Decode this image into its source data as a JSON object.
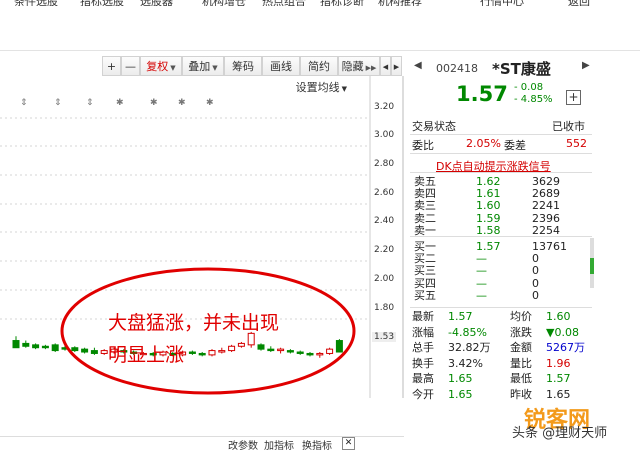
{
  "top_menu": {
    "items": [
      "条件选股",
      "指标选股",
      "选股器",
      "机构增仓",
      "热点组合",
      "指标诊断",
      "机构推荐",
      "行情中心",
      "返回"
    ]
  },
  "toolbar": {
    "plus": "+",
    "minus": "—",
    "fuquan": "复权",
    "diejia": "叠加",
    "chouma": "筹码",
    "huaxian": "画线",
    "jianyue": "简约",
    "yincang": "隐藏",
    "arrows": "▶▶",
    "nav_left": "◀",
    "nav_right": "▶"
  },
  "chart": {
    "setting_label": "设置均线",
    "price_labels": [
      "3.20",
      "3.00",
      "2.80",
      "2.60",
      "2.40",
      "2.20",
      "2.00",
      "1.80",
      "1.53"
    ],
    "annotation_lines": [
      "大盘猛涨，并未出现",
      "明显上涨"
    ],
    "bottom_tools": {
      "gai_zhibiao": "改参数",
      "jia_zhibiao": "加指标",
      "huan_zhibiao": "换指标",
      "close": "✕"
    },
    "marks": [
      "⇕",
      "⇕",
      "⇕",
      "✱",
      "✱",
      "✱",
      "✱"
    ]
  },
  "chart_data": {
    "type": "candlestick",
    "y_range": [
      1.53,
      3.2
    ],
    "candles": [
      {
        "o": 1.65,
        "h": 1.68,
        "l": 1.6,
        "c": 1.6
      },
      {
        "o": 1.63,
        "h": 1.65,
        "l": 1.6,
        "c": 1.61
      },
      {
        "o": 1.62,
        "h": 1.63,
        "l": 1.59,
        "c": 1.6
      },
      {
        "o": 1.61,
        "h": 1.62,
        "l": 1.59,
        "c": 1.6
      },
      {
        "o": 1.62,
        "h": 1.63,
        "l": 1.57,
        "c": 1.58
      },
      {
        "o": 1.6,
        "h": 1.62,
        "l": 1.58,
        "c": 1.59
      },
      {
        "o": 1.6,
        "h": 1.61,
        "l": 1.57,
        "c": 1.58
      },
      {
        "o": 1.59,
        "h": 1.6,
        "l": 1.56,
        "c": 1.57
      },
      {
        "o": 1.58,
        "h": 1.6,
        "l": 1.55,
        "c": 1.56
      },
      {
        "o": 1.56,
        "h": 1.59,
        "l": 1.55,
        "c": 1.58
      },
      {
        "o": 1.57,
        "h": 1.6,
        "l": 1.56,
        "c": 1.59
      },
      {
        "o": 1.58,
        "h": 1.59,
        "l": 1.56,
        "c": 1.57
      },
      {
        "o": 1.57,
        "h": 1.58,
        "l": 1.55,
        "c": 1.56
      },
      {
        "o": 1.56,
        "h": 1.57,
        "l": 1.55,
        "c": 1.56
      },
      {
        "o": 1.56,
        "h": 1.57,
        "l": 1.54,
        "c": 1.55
      },
      {
        "o": 1.55,
        "h": 1.58,
        "l": 1.54,
        "c": 1.57
      },
      {
        "o": 1.56,
        "h": 1.57,
        "l": 1.54,
        "c": 1.55
      },
      {
        "o": 1.55,
        "h": 1.58,
        "l": 1.54,
        "c": 1.57
      },
      {
        "o": 1.57,
        "h": 1.58,
        "l": 1.55,
        "c": 1.56
      },
      {
        "o": 1.56,
        "h": 1.57,
        "l": 1.54,
        "c": 1.55
      },
      {
        "o": 1.55,
        "h": 1.59,
        "l": 1.54,
        "c": 1.58
      },
      {
        "o": 1.57,
        "h": 1.6,
        "l": 1.56,
        "c": 1.58
      },
      {
        "o": 1.58,
        "h": 1.62,
        "l": 1.57,
        "c": 1.61
      },
      {
        "o": 1.61,
        "h": 1.64,
        "l": 1.6,
        "c": 1.63
      },
      {
        "o": 1.62,
        "h": 1.71,
        "l": 1.6,
        "c": 1.7
      },
      {
        "o": 1.62,
        "h": 1.63,
        "l": 1.58,
        "c": 1.59
      },
      {
        "o": 1.59,
        "h": 1.61,
        "l": 1.57,
        "c": 1.58
      },
      {
        "o": 1.58,
        "h": 1.6,
        "l": 1.56,
        "c": 1.59
      },
      {
        "o": 1.58,
        "h": 1.59,
        "l": 1.56,
        "c": 1.57
      },
      {
        "o": 1.57,
        "h": 1.58,
        "l": 1.55,
        "c": 1.56
      },
      {
        "o": 1.56,
        "h": 1.57,
        "l": 1.54,
        "c": 1.55
      },
      {
        "o": 1.55,
        "h": 1.57,
        "l": 1.53,
        "c": 1.56
      },
      {
        "o": 1.56,
        "h": 1.6,
        "l": 1.55,
        "c": 1.59
      },
      {
        "o": 1.65,
        "h": 1.66,
        "l": 1.57,
        "c": 1.57
      }
    ]
  },
  "quote": {
    "code": "002418",
    "name": "*ST康盛",
    "price": "1.57",
    "change": "- 0.08",
    "change_pct": "- 4.85%",
    "trade_status_label": "交易状态",
    "trade_status_value": "已收市",
    "weibi_label": "委比",
    "weibi_value": "2.05%",
    "weicha_label": "委差",
    "weicha_value": "552",
    "signal": "DK点自动提示涨跌信号",
    "sells": [
      {
        "label": "卖五",
        "price": "1.62",
        "vol": "3629"
      },
      {
        "label": "卖四",
        "price": "1.61",
        "vol": "2689"
      },
      {
        "label": "卖三",
        "price": "1.60",
        "vol": "2241"
      },
      {
        "label": "卖二",
        "price": "1.59",
        "vol": "2396"
      },
      {
        "label": "卖一",
        "price": "1.58",
        "vol": "2254"
      }
    ],
    "buys": [
      {
        "label": "买一",
        "price": "1.57",
        "vol": "13761"
      },
      {
        "label": "买二",
        "price": "—",
        "vol": "0"
      },
      {
        "label": "买三",
        "price": "—",
        "vol": "0"
      },
      {
        "label": "买四",
        "price": "—",
        "vol": "0"
      },
      {
        "label": "买五",
        "price": "—",
        "vol": "0"
      }
    ],
    "stats": [
      {
        "l1": "最新",
        "v1": "1.57",
        "c1": "g",
        "l2": "均价",
        "v2": "1.60",
        "c2": "g"
      },
      {
        "l1": "涨幅",
        "v1": "-4.85%",
        "c1": "g",
        "l2": "涨跌",
        "v2": "▼0.08",
        "c2": "g"
      },
      {
        "l1": "总手",
        "v1": "32.82万",
        "c1": "k",
        "l2": "金额",
        "v2": "5267万",
        "c2": "b"
      },
      {
        "l1": "换手",
        "v1": "3.42%",
        "c1": "k",
        "l2": "量比",
        "v2": "1.96",
        "c2": "r"
      },
      {
        "l1": "最高",
        "v1": "1.65",
        "c1": "g",
        "l2": "最低",
        "v2": "1.57",
        "c2": "g"
      },
      {
        "l1": "今开",
        "v1": "1.65",
        "c1": "g",
        "l2": "昨收",
        "v2": "1.65",
        "c2": "k"
      }
    ]
  },
  "watermark": {
    "logo": "锐客网",
    "small": "头条 @理财天师"
  },
  "colors": {
    "up": "#d40000",
    "down": "#008800",
    "annotation": "#e00000"
  }
}
